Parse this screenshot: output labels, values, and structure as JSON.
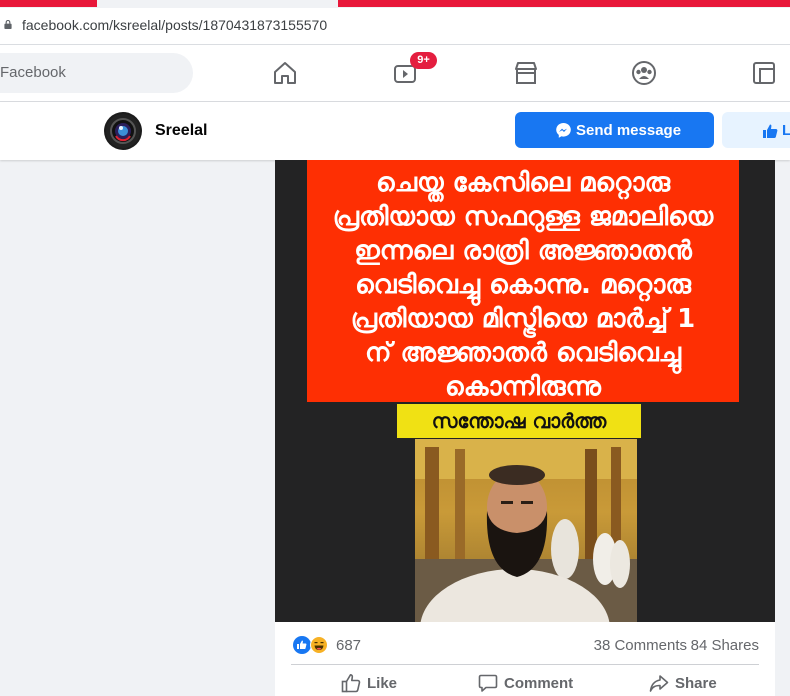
{
  "browser": {
    "url": "facebook.com/ksreelal/posts/1870431873155570"
  },
  "nav": {
    "search_placeholder": "Facebook",
    "watch_badge": "9+"
  },
  "page": {
    "name": "Sreelal",
    "send_message_label": "Send message",
    "like_label": "L"
  },
  "post": {
    "image_text_lines": [
      "ചെയ്ത കേസിലെ മറ്റൊരു",
      "പ്രതിയായ സഫറുള്ള ജമാലിയെ",
      "ഇന്നലെ രാത്രി അജ്ഞാതൻ",
      "വെടിവെച്ചു കൊന്നു. മറ്റൊരു",
      "പ്രതിയായ മിസ്ട്രിയെ മാർച്ച് 1",
      "ന് അജ്ഞാതർ വെടിവെച്ചു",
      "കൊന്നിരുന്നു"
    ],
    "image_tag": "സന്തോഷ വാർത്ത",
    "reaction_count": "687",
    "comments": "38 Comments",
    "shares": "84 Shares",
    "actions": {
      "like": "Like",
      "comment": "Comment",
      "share": "Share"
    }
  },
  "colors": {
    "facebook_blue": "#1877f2",
    "tab_red": "#e8173a",
    "image_red": "#fe2f03",
    "tag_yellow": "#f0e114"
  }
}
